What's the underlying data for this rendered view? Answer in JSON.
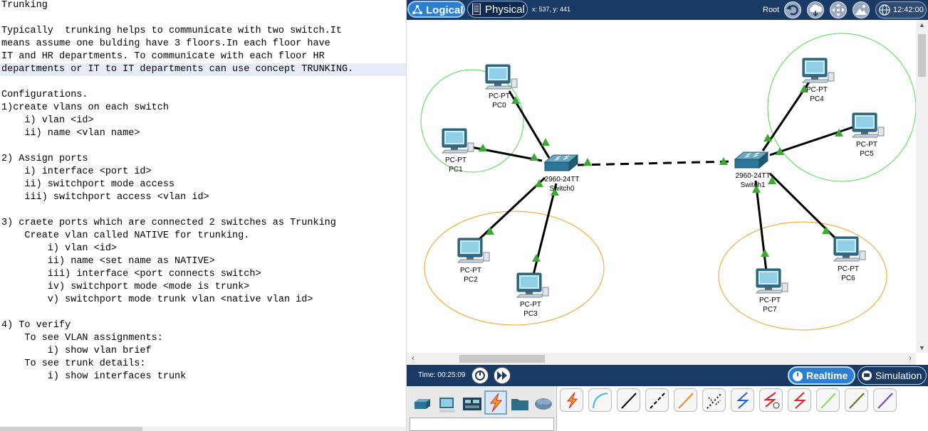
{
  "notes": {
    "lines": [
      "Trunking",
      "",
      "Typically  trunking helps to communicate with two switch.It",
      "means assume one bulding have 3 floors.In each floor have",
      "IT and HR departments. To communicate with each floor HR",
      "departments or IT to IT departments can use concept TRUNKING.",
      "",
      "Configurations.",
      "1)create vlans on each switch",
      "    i) vlan <id>",
      "    ii) name <vlan name>",
      "",
      "2) Assign ports",
      "    i) interface <port id>",
      "    ii) switchport mode access",
      "    iii) switchport access <vlan id>",
      "",
      "3) craete ports which are connected 2 switches as Trunking",
      "    Create vlan called NATIVE for trunking.",
      "        i) vlan <id>",
      "        ii) name <set name as NATIVE>",
      "        iii) interface <port connects switch>",
      "        iv) switchport mode <mode is trunk>",
      "        v) switchport mode trunk vlan <native vlan id>",
      "",
      "4) To verify",
      "    To see VLAN assignments:",
      "        i) show vlan brief",
      "    To see trunk details:",
      "        i) show interfaces trunk"
    ]
  },
  "toolbar": {
    "logical_label": "Logical",
    "physical_label": "Physical",
    "coords": "x: 537, y: 441",
    "root_label": "Root",
    "clock": "12:42:00"
  },
  "timebar": {
    "time": "Time: 00:25:09",
    "realtime_label": "Realtime",
    "simulation_label": "Simulation"
  },
  "topology": {
    "devices": {
      "pc0": {
        "type": "PC-PT",
        "name": "PC0"
      },
      "pc1": {
        "type": "PC-PT",
        "name": "PC1"
      },
      "pc2": {
        "type": "PC-PT",
        "name": "PC2"
      },
      "pc3": {
        "type": "PC-PT",
        "name": "PC3"
      },
      "pc4": {
        "type": "PC-PT",
        "name": "PC4"
      },
      "pc5": {
        "type": "PC-PT",
        "name": "PC5"
      },
      "pc6": {
        "type": "PC-PT",
        "name": "PC6"
      },
      "pc7": {
        "type": "PC-PT",
        "name": "PC7"
      },
      "switch0": {
        "type": "2960-24TT",
        "name": "Switch0"
      },
      "switch1": {
        "type": "2960-24TT",
        "name": "Switch1"
      }
    },
    "link_up_color": "#3aaa35",
    "group_colors": {
      "it": "#4cd94c",
      "hr": "#f0a020"
    }
  },
  "colors": {
    "toolbar_bg": "#1a3a66",
    "active_tab": "#2a7fd0"
  },
  "icons": {
    "category_icons": [
      "network-devices-icon",
      "end-devices-icon",
      "components-icon",
      "connections-icon",
      "miscellaneous-icon",
      "multiuser-icon"
    ],
    "connection_icons": [
      "automatic-connection-icon",
      "console-cable-icon",
      "copper-straight-through-icon",
      "copper-cross-over-icon",
      "fiber-icon",
      "phone-cable-icon",
      "coaxial-cable-icon",
      "serial-dce-icon",
      "serial-dte-icon",
      "octal-cable-icon",
      "iot-custom-cable-icon",
      "usb-cable-icon"
    ]
  }
}
